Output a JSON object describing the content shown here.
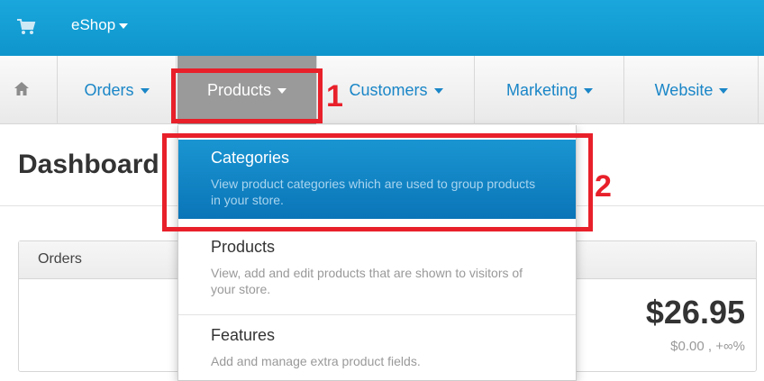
{
  "topbar": {
    "brand": "eShop",
    "colors": {
      "background": "#1aa7dc",
      "text": "#ffffff"
    }
  },
  "nav": {
    "items": [
      {
        "label": "Orders",
        "active": false
      },
      {
        "label": "Products",
        "active": true
      },
      {
        "label": "Customers",
        "active": false
      },
      {
        "label": "Marketing",
        "active": false
      },
      {
        "label": "Website",
        "active": false
      }
    ]
  },
  "page": {
    "title": "Dashboard"
  },
  "orders_panel": {
    "title": "Orders",
    "amount": "$26.95",
    "subamount": "$0.00 , +∞%"
  },
  "dropdown": {
    "items": [
      {
        "label": "Categories",
        "description": "View product categories which are used to group products in your store.",
        "active": true
      },
      {
        "label": "Products",
        "description": "View, add and edit products that are shown to visitors of your store.",
        "active": false
      },
      {
        "label": "Features",
        "description": "Add and manage extra product fields.",
        "active": false
      }
    ]
  },
  "annotations": {
    "step1": "1",
    "step2": "2",
    "color": "#e8202a"
  }
}
